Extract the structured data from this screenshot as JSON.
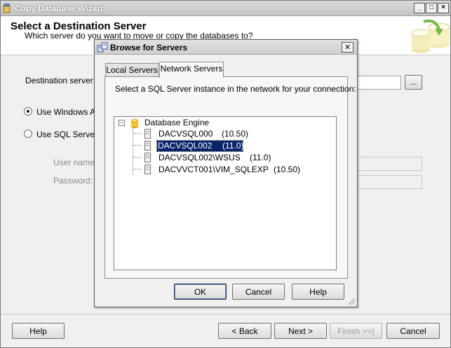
{
  "wizard": {
    "title": "Copy Database Wizard",
    "heading": "Select a Destination Server",
    "subheading": "Which server do you want to move or copy the databases to?",
    "destination_label": "Destination server:",
    "browse_label": "...",
    "windows_auth_label": "Use Windows Au",
    "sql_auth_label": "Use SQL Server.",
    "username_label": "User name:",
    "password_label": "Password:",
    "buttons": {
      "help": "Help",
      "back": "< Back",
      "next": "Next >",
      "finish": "Finish >>|",
      "cancel": "Cancel"
    }
  },
  "dialog": {
    "title": "Browse for Servers",
    "close_label": "✕",
    "tabs": [
      {
        "label": "Local Servers",
        "active": false
      },
      {
        "label": "Network Servers",
        "active": true
      }
    ],
    "instruction": "Select a SQL Server instance in the network for your connection:",
    "tree": {
      "root_label": "Database Engine",
      "expander_label": "−",
      "items": [
        {
          "name": "DACVSQL000",
          "version": "(10.50)",
          "selected": false
        },
        {
          "name": "DACVSQL002",
          "version": "(11.0)",
          "selected": true
        },
        {
          "name": "DACVSQL002\\WSUS",
          "version": "(11.0)",
          "selected": false
        },
        {
          "name": "DACVVCT001\\VIM_SQLEXP",
          "version": "(10.50)",
          "selected": false
        }
      ]
    },
    "buttons": {
      "ok": "OK",
      "cancel": "Cancel",
      "help": "Help"
    }
  }
}
